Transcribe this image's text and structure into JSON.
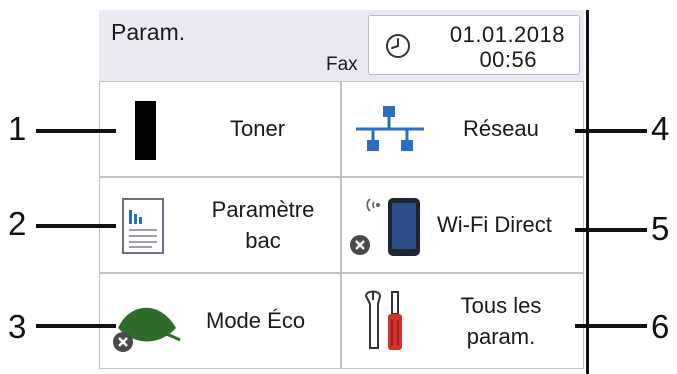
{
  "header": {
    "title": "Param.",
    "mode": "Fax",
    "date": "01.01.2018",
    "time": "00:56"
  },
  "tiles": [
    {
      "label": "Toner",
      "icon": "toner-icon"
    },
    {
      "label_line1": "Paramètre",
      "label_line2": "bac",
      "icon": "tray-settings-icon"
    },
    {
      "label": "Mode Éco",
      "icon": "eco-leaf-icon"
    },
    {
      "label": "Réseau",
      "icon": "network-icon"
    },
    {
      "label": "Wi-Fi Direct",
      "icon": "wifi-direct-phone-icon"
    },
    {
      "label_line1": "Tous les",
      "label_line2": "param.",
      "icon": "tools-icon"
    }
  ],
  "callouts": [
    "1",
    "2",
    "3",
    "4",
    "5",
    "6"
  ],
  "colors": {
    "header_bg": "#e8ecf2",
    "network_blue": "#2b6cc4",
    "leaf_green": "#2f6b2a",
    "screwdriver_red": "#d0312d"
  }
}
